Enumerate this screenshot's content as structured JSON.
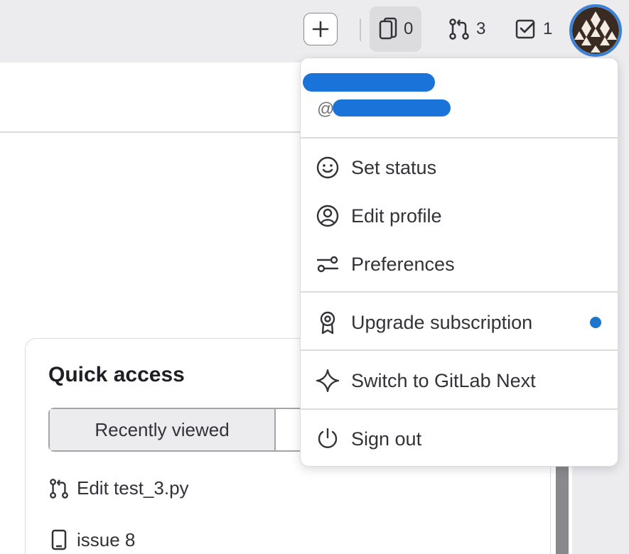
{
  "topbar": {
    "issues_count": "0",
    "merge_requests_count": "3",
    "todos_count": "1"
  },
  "user_menu": {
    "handle_prefix": "@",
    "items": {
      "set_status": "Set status",
      "edit_profile": "Edit profile",
      "preferences": "Preferences",
      "upgrade_subscription": "Upgrade subscription",
      "switch_next": "Switch to GitLab Next",
      "sign_out": "Sign out"
    }
  },
  "quick_access": {
    "title": "Quick access",
    "tabs": [
      "Recently viewed"
    ],
    "items": [
      {
        "label": "Edit test_3.py",
        "icon": "merge-request-icon"
      },
      {
        "label": "issue 8",
        "icon": "issue-icon"
      }
    ]
  },
  "colors": {
    "accent": "#1f75cb",
    "redaction": "#1a73d9",
    "topbar_bg": "#ececef"
  }
}
